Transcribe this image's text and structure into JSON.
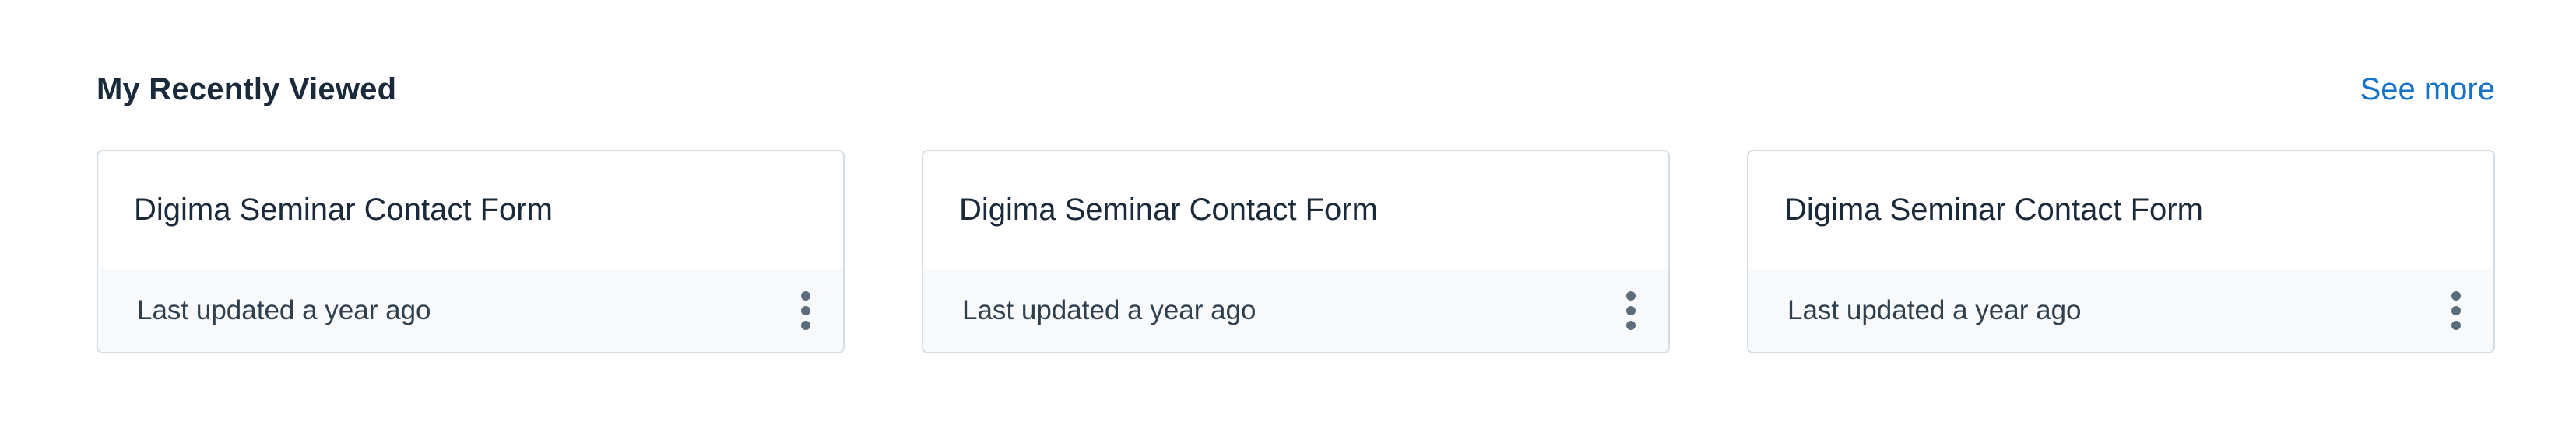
{
  "section": {
    "title": "My Recently Viewed",
    "see_more_label": "See more"
  },
  "cards": [
    {
      "title": "Digima Seminar Contact Form",
      "meta": "Last updated a year ago",
      "menu_icon": "more-vertical-icon"
    },
    {
      "title": "Digima Seminar Contact Form",
      "meta": "Last updated a year ago",
      "menu_icon": "more-vertical-icon"
    },
    {
      "title": "Digima Seminar Contact Form",
      "meta": "Last updated a year ago",
      "menu_icon": "more-vertical-icon"
    }
  ],
  "colors": {
    "link": "#1673c8",
    "text": "#1b2a3a",
    "border": "#d3dde6",
    "card_footer_bg": "#f7f9fb",
    "icon": "#5b6d7c"
  }
}
